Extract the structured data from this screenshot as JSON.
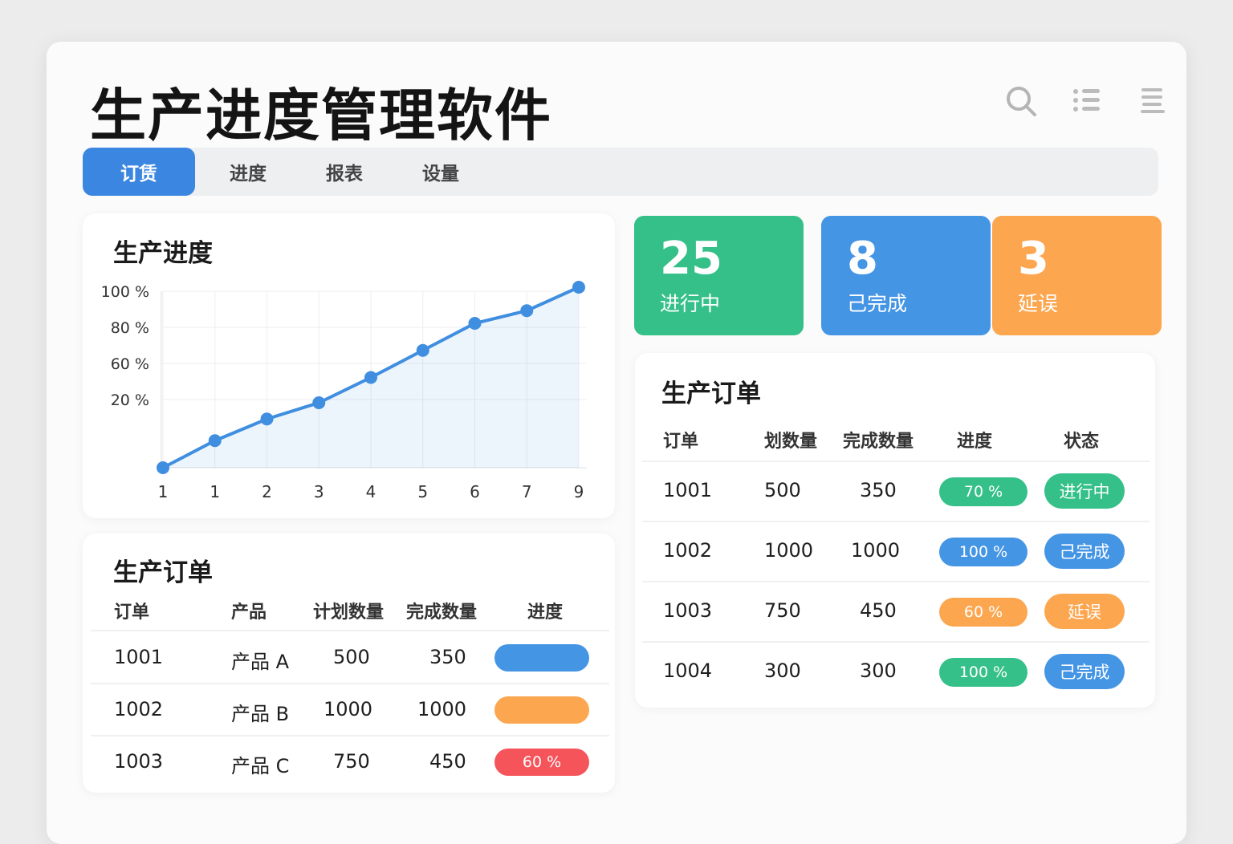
{
  "app": {
    "title": "生产进度管理软件"
  },
  "tabs": [
    {
      "label": "订赁"
    },
    {
      "label": "进度"
    },
    {
      "label": "报表"
    },
    {
      "label": "设量"
    }
  ],
  "colors": {
    "green": "#34c088",
    "blue": "#4595e5",
    "orange": "#fca64f",
    "red": "#f4545a",
    "tabActive": "#3b86e0"
  },
  "chart_card": {
    "title": "生产进度"
  },
  "chart_data": {
    "type": "line",
    "title": "生产进度",
    "x_labels": [
      "1",
      "1",
      "2",
      "3",
      "4",
      "5",
      "6",
      "7",
      "9"
    ],
    "values": [
      0,
      15,
      27,
      36,
      50,
      65,
      80,
      87,
      100
    ],
    "y_ticks": [
      {
        "value": 100,
        "label": "100 %"
      },
      {
        "value": 80,
        "label": "80 %"
      },
      {
        "value": 60,
        "label": "60 %"
      },
      {
        "value": 40,
        "label": "20 %"
      }
    ],
    "ylim": [
      0,
      100
    ],
    "grid": true
  },
  "stats": [
    {
      "value": "25",
      "label": "进行中",
      "color": "#34c088"
    },
    {
      "value": "8",
      "label": "己完成",
      "color": "#4595e5"
    },
    {
      "value": "3",
      "label": "延误",
      "color": "#fca64f"
    }
  ],
  "right_table": {
    "title": "生产订单",
    "headers": [
      "订单",
      "划数量",
      "完成数量",
      "进度",
      "状态"
    ],
    "rows": [
      {
        "id": "1001",
        "plan": "500",
        "done": "350",
        "progress": "70 %",
        "status": "进行中",
        "pc": "#34c088",
        "sc": "#34c088"
      },
      {
        "id": "1002",
        "plan": "1000",
        "done": "1000",
        "progress": "100 %",
        "status": "己完成",
        "pc": "#4595e5",
        "sc": "#4595e5"
      },
      {
        "id": "1003",
        "plan": "750",
        "done": "450",
        "progress": "60 %",
        "status": "延误",
        "pc": "#fca64f",
        "sc": "#fca64f"
      },
      {
        "id": "1004",
        "plan": "300",
        "done": "300",
        "progress": "100 %",
        "status": "己完成",
        "pc": "#34c088",
        "sc": "#4595e5"
      }
    ]
  },
  "left_table": {
    "title": "生产订单",
    "headers": [
      "订单",
      "产品",
      "计划数量",
      "完成数量",
      "进度"
    ],
    "rows": [
      {
        "id": "1001",
        "product": "产品 A",
        "plan": "500",
        "done": "350",
        "progress": "",
        "color": "#4595e5"
      },
      {
        "id": "1002",
        "product": "产品 B",
        "plan": "1000",
        "done": "1000",
        "progress": "",
        "color": "#fca64f"
      },
      {
        "id": "1003",
        "product": "产品 C",
        "plan": "750",
        "done": "450",
        "progress": "60 %",
        "color": "#f4545a"
      }
    ]
  }
}
